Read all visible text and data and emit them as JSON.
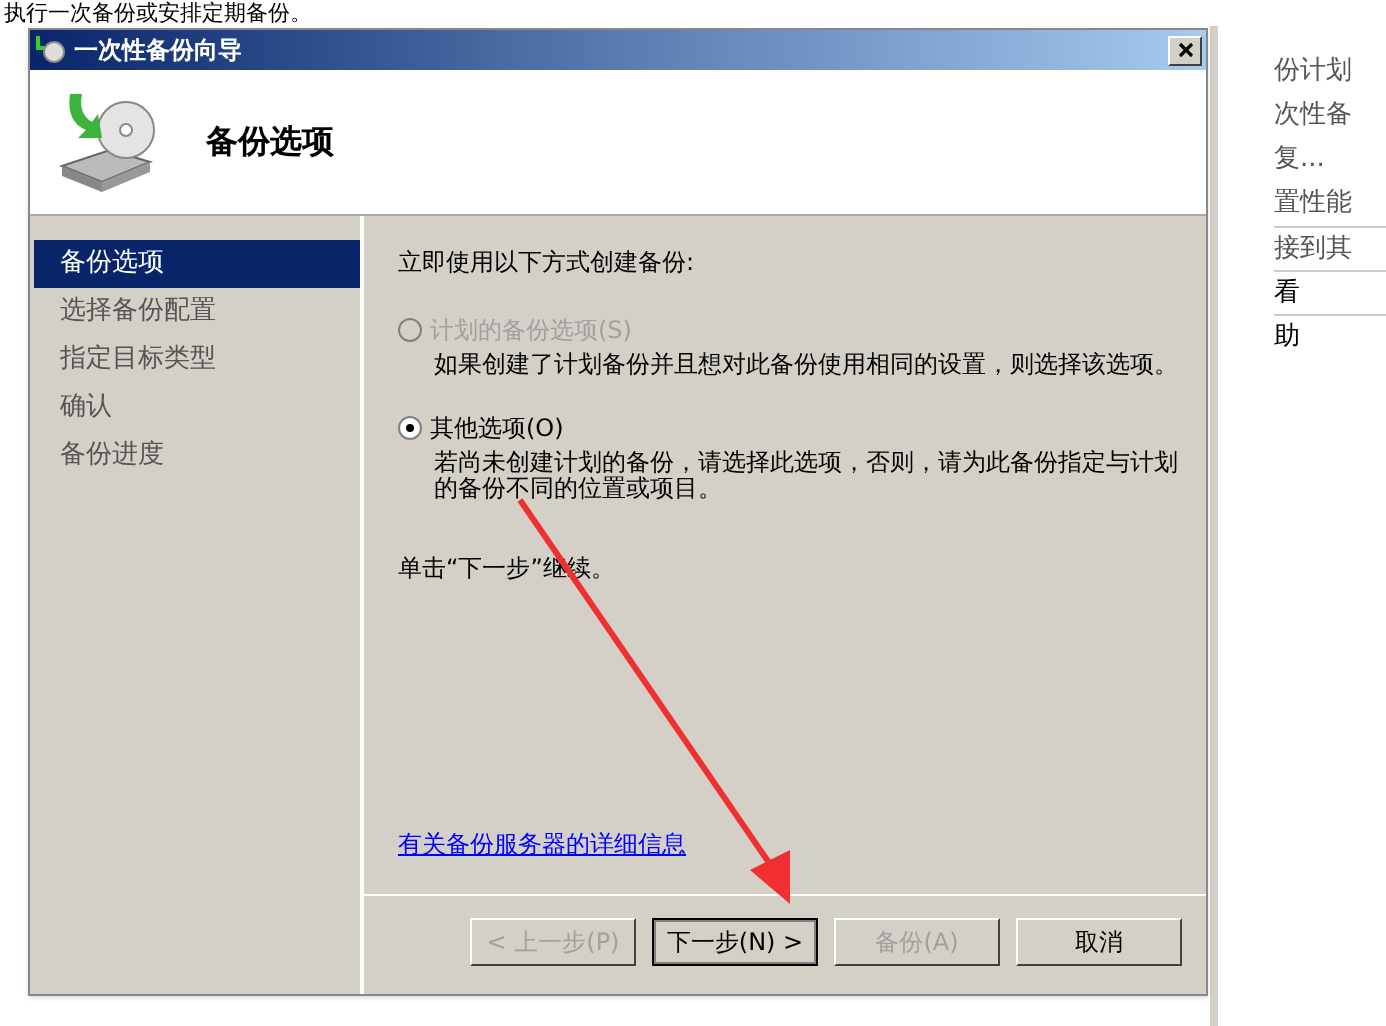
{
  "background": {
    "text": "执行一次备份或安排定期备份。",
    "actions": [
      {
        "label": "份计划"
      },
      {
        "label": "次性备"
      },
      {
        "label": "复..."
      },
      {
        "label": "置性能"
      },
      {
        "label": "接到其"
      },
      {
        "label": "看"
      },
      {
        "label": "助"
      }
    ]
  },
  "dialog": {
    "title": "一次性备份向导",
    "header": "备份选项",
    "steps": [
      {
        "label": "备份选项",
        "selected": true
      },
      {
        "label": "选择备份配置",
        "selected": false
      },
      {
        "label": "指定目标类型",
        "selected": false
      },
      {
        "label": "确认",
        "selected": false
      },
      {
        "label": "备份进度",
        "selected": false
      }
    ],
    "prompt": "立即使用以下方式创建备份:",
    "options": [
      {
        "label": "计划的备份选项(S)",
        "description": "如果创建了计划备份并且想对此备份使用相同的设置，则选择该选项。",
        "selected": false,
        "disabled": true
      },
      {
        "label": "其他选项(O)",
        "description": "若尚未创建计划的备份，请选择此选项，否则，请为此备份指定与计划的备份不同的位置或项目。",
        "selected": true,
        "disabled": false
      }
    ],
    "hint": "单击“下一步”继续。",
    "link": "有关备份服务器的详细信息",
    "buttons": [
      {
        "label": "< 上一步(P)",
        "disabled": true,
        "default": false
      },
      {
        "label": "下一步(N) >",
        "disabled": false,
        "default": true
      },
      {
        "label": "备份(A)",
        "disabled": true,
        "default": false
      },
      {
        "label": "取消",
        "disabled": false,
        "default": false
      }
    ]
  }
}
